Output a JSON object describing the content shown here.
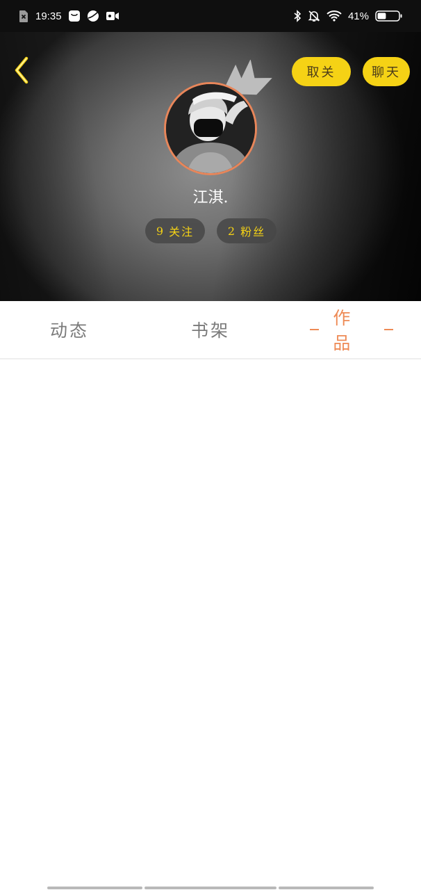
{
  "status_bar": {
    "time": "19:35",
    "battery_percent": "41%",
    "battery_level": 0.41,
    "icons_left": [
      "sim-off-icon",
      "shopping-bag-icon",
      "browser-icon",
      "video-icon"
    ],
    "icons_right": [
      "bluetooth-icon",
      "bell-off-icon",
      "wifi-icon",
      "battery-icon"
    ]
  },
  "header": {
    "unfollow_label": "取关",
    "chat_label": "聊天",
    "username": "江淇.",
    "following_count": "9",
    "following_label": "关注",
    "fans_count": "2",
    "fans_label": "粉丝",
    "accent_color": "#f5d215",
    "avatar_ring_color": "#e8865a"
  },
  "tabs": [
    {
      "label": "动态",
      "active": false
    },
    {
      "label": "书架",
      "active": false
    },
    {
      "label": "作品",
      "active": true
    }
  ],
  "active_tab_color": "#ee8a55"
}
